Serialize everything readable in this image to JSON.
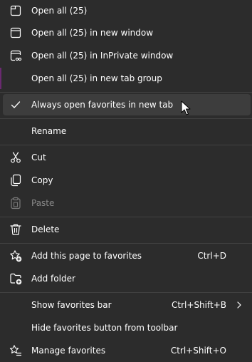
{
  "menu": {
    "items": [
      {
        "label": "Open all (25)",
        "icon": "tab-icon"
      },
      {
        "label": "Open all (25) in new window",
        "icon": "window-icon"
      },
      {
        "label": "Open all (25) in InPrivate window",
        "icon": "inprivate-window-icon"
      },
      {
        "label": "Open all (25) in new tab group",
        "icon": ""
      },
      {
        "label": "Always open favorites in new tab",
        "icon": "checkmark-icon",
        "checked": true
      },
      {
        "label": "Rename",
        "icon": ""
      },
      {
        "label": "Cut",
        "icon": "scissors-icon"
      },
      {
        "label": "Copy",
        "icon": "copy-icon"
      },
      {
        "label": "Paste",
        "icon": "clipboard-icon",
        "disabled": true
      },
      {
        "label": "Delete",
        "icon": "trash-icon"
      },
      {
        "label": "Add this page to favorites",
        "icon": "star-add-icon",
        "shortcut": "Ctrl+D"
      },
      {
        "label": "Add folder",
        "icon": "folder-add-icon"
      },
      {
        "label": "Show favorites bar",
        "icon": "",
        "shortcut": "Ctrl+Shift+B",
        "submenu": true
      },
      {
        "label": "Hide favorites button from toolbar",
        "icon": ""
      },
      {
        "label": "Manage favorites",
        "icon": "star-list-icon",
        "shortcut": "Ctrl+Shift+O"
      }
    ]
  },
  "colors": {
    "background": "#2c2c2c",
    "hover": "#3d3d3d",
    "separator": "#414141",
    "text": "#ffffff",
    "disabled_text": "#8a8a8a"
  }
}
